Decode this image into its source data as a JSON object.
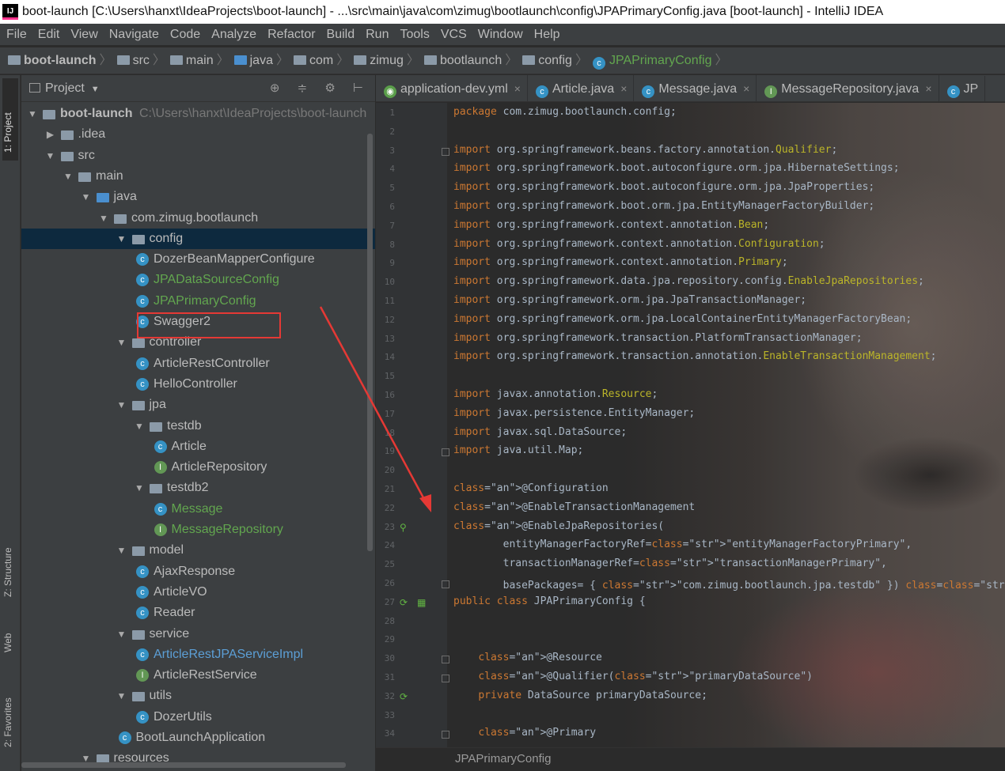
{
  "window": {
    "title": "boot-launch [C:\\Users\\hanxt\\IdeaProjects\\boot-launch] - ...\\src\\main\\java\\com\\zimug\\bootlaunch\\config\\JPAPrimaryConfig.java [boot-launch] - IntelliJ IDEA",
    "logo": "IJ"
  },
  "menu": [
    "File",
    "Edit",
    "View",
    "Navigate",
    "Code",
    "Analyze",
    "Refactor",
    "Build",
    "Run",
    "Tools",
    "VCS",
    "Window",
    "Help"
  ],
  "breadcrumb": [
    "boot-launch",
    "src",
    "main",
    "java",
    "com",
    "zimug",
    "bootlaunch",
    "config",
    "JPAPrimaryConfig"
  ],
  "left_strip": {
    "project_tab": "1: Project",
    "structure_tab": "Z: Structure",
    "web_tab": "Web",
    "favorites_tab": "2: Favorites"
  },
  "project_panel": {
    "title": "Project",
    "tools": "⊕ ≑ ⚙ ⊢",
    "tree": [
      {
        "label": "boot-launch",
        "path": "C:\\Users\\hanxt\\IdeaProjects\\boot-launch",
        "type": "module",
        "expanded": true
      },
      {
        "label": ".idea",
        "type": "folder",
        "expanded": false
      },
      {
        "label": "src",
        "type": "folder",
        "expanded": true
      },
      {
        "label": "main",
        "type": "folder",
        "expanded": true
      },
      {
        "label": "java",
        "type": "source-folder",
        "expanded": true
      },
      {
        "label": "com.zimug.bootlaunch",
        "type": "package",
        "expanded": true
      },
      {
        "label": "config",
        "type": "package",
        "expanded": true,
        "selected": true
      },
      {
        "label": "DozerBeanMapperConfigure",
        "type": "class"
      },
      {
        "label": "JPADataSourceConfig",
        "type": "class",
        "color": "green"
      },
      {
        "label": "JPAPrimaryConfig",
        "type": "class",
        "color": "green",
        "highlighted": true
      },
      {
        "label": "Swagger2",
        "type": "class"
      },
      {
        "label": "controller",
        "type": "package",
        "expanded": true
      },
      {
        "label": "ArticleRestController",
        "type": "class"
      },
      {
        "label": "HelloController",
        "type": "class"
      },
      {
        "label": "jpa",
        "type": "package",
        "expanded": true
      },
      {
        "label": "testdb",
        "type": "package",
        "expanded": true
      },
      {
        "label": "Article",
        "type": "class"
      },
      {
        "label": "ArticleRepository",
        "type": "interface"
      },
      {
        "label": "testdb2",
        "type": "package",
        "expanded": true
      },
      {
        "label": "Message",
        "type": "class",
        "color": "green"
      },
      {
        "label": "MessageRepository",
        "type": "interface",
        "color": "green"
      },
      {
        "label": "model",
        "type": "package",
        "expanded": true
      },
      {
        "label": "AjaxResponse",
        "type": "class"
      },
      {
        "label": "ArticleVO",
        "type": "class"
      },
      {
        "label": "Reader",
        "type": "class"
      },
      {
        "label": "service",
        "type": "package",
        "expanded": true
      },
      {
        "label": "ArticleRestJPAServiceImpl",
        "type": "class",
        "color": "blue"
      },
      {
        "label": "ArticleRestService",
        "type": "interface"
      },
      {
        "label": "utils",
        "type": "package",
        "expanded": true
      },
      {
        "label": "DozerUtils",
        "type": "class"
      },
      {
        "label": "BootLaunchApplication",
        "type": "class"
      },
      {
        "label": "resources",
        "type": "folder",
        "expanded": true
      }
    ]
  },
  "editor_tabs": [
    {
      "label": "application-dev.yml",
      "icon": "yml",
      "close": "×"
    },
    {
      "label": "Article.java",
      "icon": "class",
      "close": "×"
    },
    {
      "label": "Message.java",
      "icon": "class",
      "close": "×"
    },
    {
      "label": "MessageRepository.java",
      "icon": "interface",
      "close": "×"
    },
    {
      "label": "JP",
      "icon": "class",
      "close": ""
    }
  ],
  "code_lines": [
    "package com.zimug.bootlaunch.config;",
    "",
    "import org.springframework.beans.factory.annotation.Qualifier;",
    "import org.springframework.boot.autoconfigure.orm.jpa.HibernateSettings;",
    "import org.springframework.boot.autoconfigure.orm.jpa.JpaProperties;",
    "import org.springframework.boot.orm.jpa.EntityManagerFactoryBuilder;",
    "import org.springframework.context.annotation.Bean;",
    "import org.springframework.context.annotation.Configuration;",
    "import org.springframework.context.annotation.Primary;",
    "import org.springframework.data.jpa.repository.config.EnableJpaRepositories;",
    "import org.springframework.orm.jpa.JpaTransactionManager;",
    "import org.springframework.orm.jpa.LocalContainerEntityManagerFactoryBean;",
    "import org.springframework.transaction.PlatformTransactionManager;",
    "import org.springframework.transaction.annotation.EnableTransactionManagement;",
    "",
    "import javax.annotation.Resource;",
    "import javax.persistence.EntityManager;",
    "import javax.sql.DataSource;",
    "import java.util.Map;",
    "",
    "@Configuration",
    "@EnableTransactionManagement",
    "@EnableJpaRepositories(",
    "        entityManagerFactoryRef=\"entityManagerFactoryPrimary\",",
    "        transactionManagerRef=\"transactionManagerPrimary\",",
    "        basePackages= { \"com.zimug.bootlaunch.jpa.testdb\" }) //设置Repository所在位置",
    "public class JPAPrimaryConfig {",
    "",
    "",
    "    @Resource",
    "    @Qualifier(\"primaryDataSource\")",
    "    private DataSource primaryDataSource;",
    "",
    "    @Primary"
  ],
  "status_breadcrumb": "JPAPrimaryConfig",
  "colors": {
    "accent_red": "#e53935",
    "selection": "#0d293e",
    "keyword": "#cc7832",
    "annotation": "#bbb529",
    "string": "#6a8759"
  }
}
